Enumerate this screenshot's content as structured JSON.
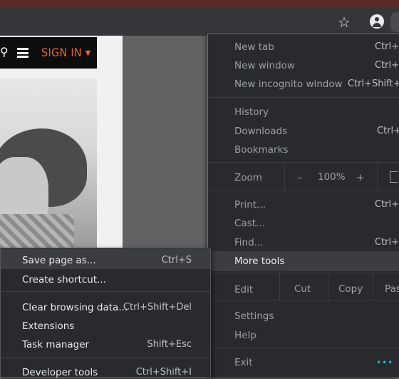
{
  "browser": {
    "star_icon": "star-icon",
    "account_icon": "account-icon"
  },
  "page": {
    "signin_label": "SIGN IN ▾"
  },
  "menu": {
    "new_tab": "New tab",
    "new_tab_sc": "Ctrl+T",
    "new_window": "New window",
    "new_window_sc": "Ctrl+N",
    "new_incognito": "New incognito window",
    "new_incognito_sc": "Ctrl+Shift+N",
    "history": "History",
    "downloads": "Downloads",
    "downloads_sc": "Ctrl+J",
    "bookmarks": "Bookmarks",
    "zoom_label": "Zoom",
    "zoom_minus": "–",
    "zoom_value": "100%",
    "zoom_plus": "+",
    "print": "Print...",
    "print_sc": "Ctrl+P",
    "cast": "Cast...",
    "find": "Find...",
    "find_sc": "Ctrl+F",
    "more_tools": "More tools",
    "edit": "Edit",
    "cut": "Cut",
    "copy": "Copy",
    "paste": "Pas",
    "settings": "Settings",
    "help": "Help",
    "exit": "Exit"
  },
  "submenu": {
    "save_page": "Save page as...",
    "save_page_sc": "Ctrl+S",
    "create_shortcut": "Create shortcut...",
    "clear_data": "Clear browsing data...",
    "clear_data_sc": "Ctrl+Shift+Del",
    "extensions": "Extensions",
    "task_manager": "Task manager",
    "task_manager_sc": "Shift+Esc",
    "dev_tools": "Developer tools",
    "dev_tools_sc": "Ctrl+Shift+I"
  },
  "misc": {
    "dots": "•••"
  }
}
